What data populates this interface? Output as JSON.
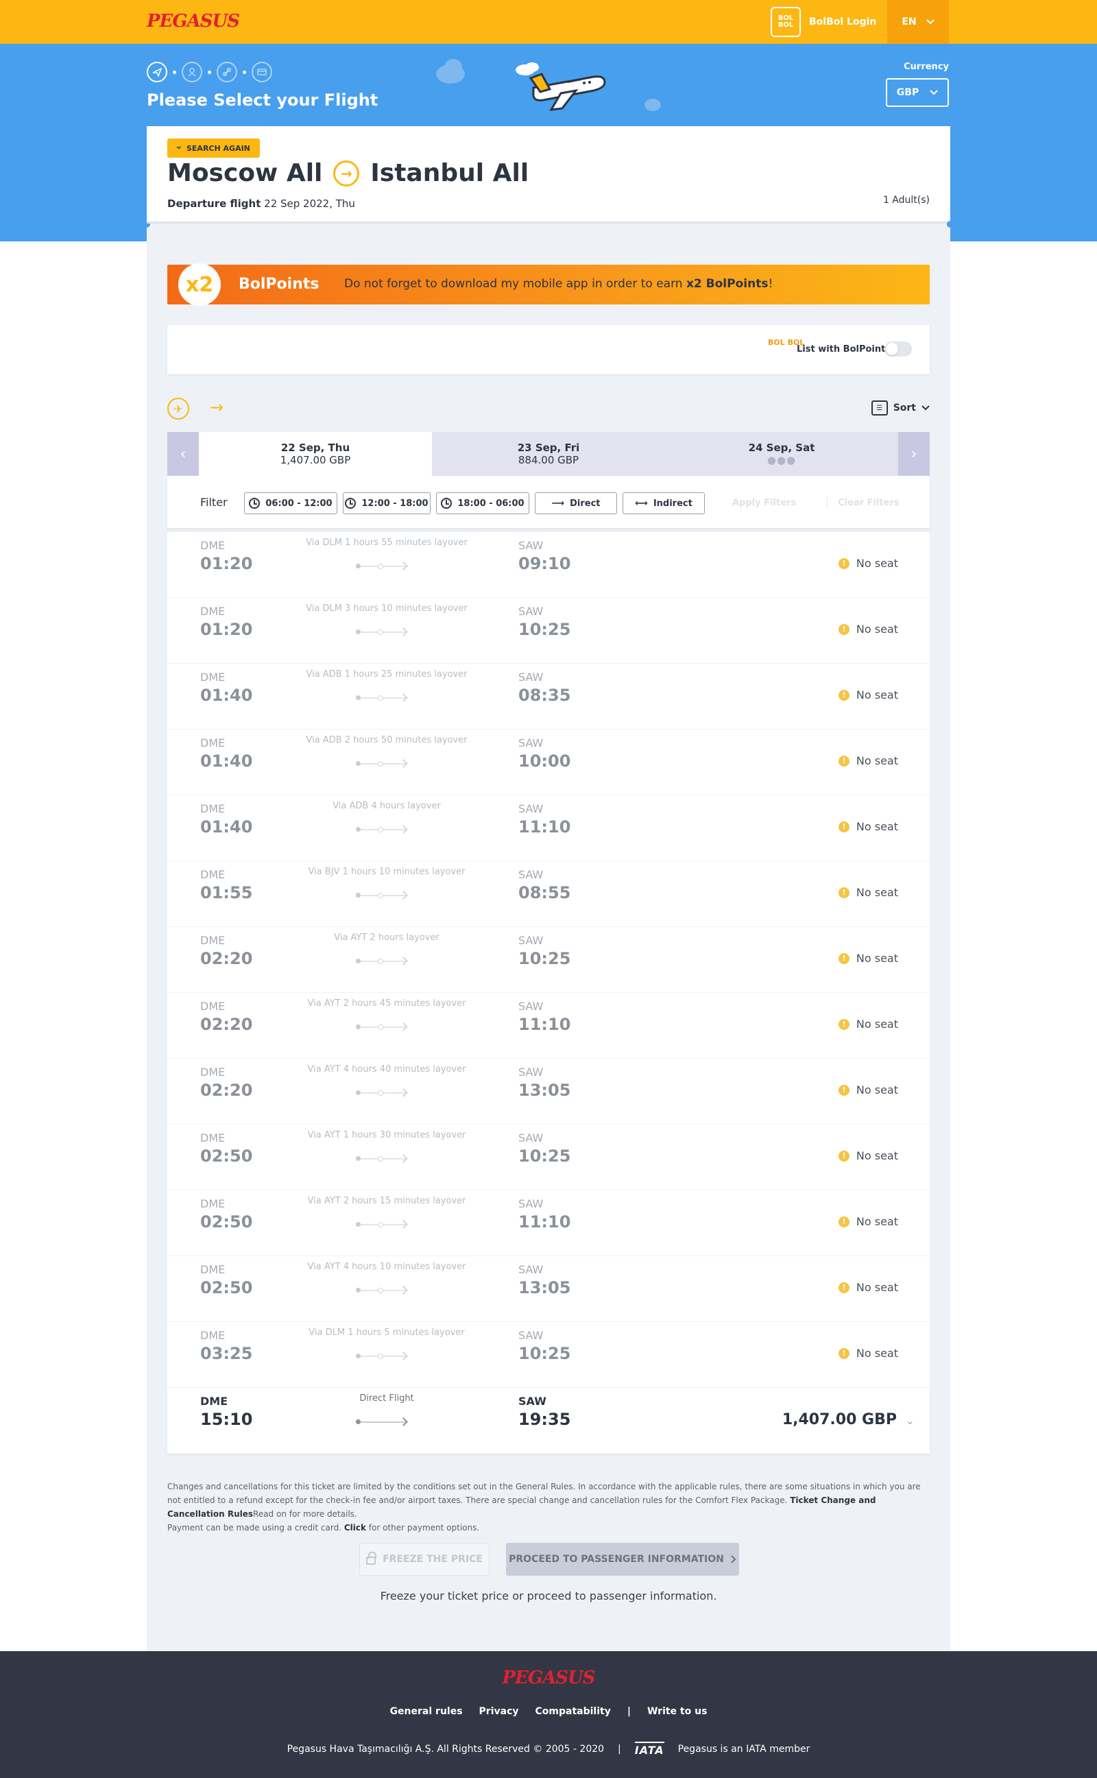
{
  "header": {
    "logo": "PEGASUS",
    "bolbol_badge": "BOL BOL",
    "login_label": "BolBol Login",
    "language": "EN"
  },
  "hero": {
    "title": "Please Select your Flight",
    "currency_label": "Currency",
    "currency_value": "GBP"
  },
  "search": {
    "search_again": "SEARCH AGAIN",
    "origin": "Moscow All",
    "destination": "Istanbul All",
    "departure_label": "Departure flight",
    "departure_date": "22 Sep 2022, Thu",
    "passengers": "1 Adult(s)"
  },
  "promo": {
    "multiplier": "x2",
    "title": "BolPoints",
    "text_before": "Do not forget to download my mobile app in order to earn ",
    "text_bold": "x2 BolPoints",
    "text_after": "!"
  },
  "bolpoints_toggle": {
    "logo": "BOL BOL",
    "label": "List with BolPoints",
    "enabled": false
  },
  "sort_label": "Sort",
  "dates": [
    {
      "date": "22 Sep, Thu",
      "price": "1,407.00 GBP",
      "selected": true
    },
    {
      "date": "23 Sep, Fri",
      "price": "884.00 GBP",
      "selected": false
    },
    {
      "date": "24 Sep, Sat",
      "price": "",
      "selected": false
    }
  ],
  "filters": {
    "label": "Filter",
    "time_slots": [
      "06:00 - 12:00",
      "12:00 - 18:00",
      "18:00 - 06:00"
    ],
    "direct": "Direct",
    "indirect": "Indirect",
    "apply": "Apply Filters",
    "clear": "Clear Filters"
  },
  "flights": [
    {
      "from": "DME",
      "dep": "01:20",
      "via": "Via DLM 1 hours 55 minutes layover",
      "to": "SAW",
      "arr": "09:10",
      "status": "No seat"
    },
    {
      "from": "DME",
      "dep": "01:20",
      "via": "Via DLM 3 hours 10 minutes layover",
      "to": "SAW",
      "arr": "10:25",
      "status": "No seat"
    },
    {
      "from": "DME",
      "dep": "01:40",
      "via": "Via ADB 1 hours 25 minutes layover",
      "to": "SAW",
      "arr": "08:35",
      "status": "No seat"
    },
    {
      "from": "DME",
      "dep": "01:40",
      "via": "Via ADB 2 hours 50 minutes layover",
      "to": "SAW",
      "arr": "10:00",
      "status": "No seat"
    },
    {
      "from": "DME",
      "dep": "01:40",
      "via": "Via ADB 4 hours layover",
      "to": "SAW",
      "arr": "11:10",
      "status": "No seat"
    },
    {
      "from": "DME",
      "dep": "01:55",
      "via": "Via BJV 1 hours 10 minutes layover",
      "to": "SAW",
      "arr": "08:55",
      "status": "No seat"
    },
    {
      "from": "DME",
      "dep": "02:20",
      "via": "Via AYT 2 hours layover",
      "to": "SAW",
      "arr": "10:25",
      "status": "No seat"
    },
    {
      "from": "DME",
      "dep": "02:20",
      "via": "Via AYT 2 hours 45 minutes layover",
      "to": "SAW",
      "arr": "11:10",
      "status": "No seat"
    },
    {
      "from": "DME",
      "dep": "02:20",
      "via": "Via AYT 4 hours 40 minutes layover",
      "to": "SAW",
      "arr": "13:05",
      "status": "No seat"
    },
    {
      "from": "DME",
      "dep": "02:50",
      "via": "Via AYT 1 hours 30 minutes layover",
      "to": "SAW",
      "arr": "10:25",
      "status": "No seat"
    },
    {
      "from": "DME",
      "dep": "02:50",
      "via": "Via AYT 2 hours 15 minutes layover",
      "to": "SAW",
      "arr": "11:10",
      "status": "No seat"
    },
    {
      "from": "DME",
      "dep": "02:50",
      "via": "Via AYT 4 hours 10 minutes layover",
      "to": "SAW",
      "arr": "13:05",
      "status": "No seat"
    },
    {
      "from": "DME",
      "dep": "03:25",
      "via": "Via DLM 1 hours 5 minutes layover",
      "to": "SAW",
      "arr": "10:25",
      "status": "No seat"
    }
  ],
  "direct_flight": {
    "from": "DME",
    "dep": "15:10",
    "via": "Direct Flight",
    "to": "SAW",
    "arr": "19:35",
    "price": "1,407.00 GBP"
  },
  "rules": {
    "text1": "Changes and cancellations for this ticket are limited by the conditions set out in the General Rules. In accordance with the applicable rules, there are some situations in which you are not entitled to a refund except for the check-in fee and/or airport taxes. There are special change and cancellation rules for the Comfort Flex Package. ",
    "link1": "Ticket Change and Cancellation Rules",
    "text2": "Read on for more details.",
    "text3": "Payment can be made using a credit card. ",
    "link2": "Click",
    "text4": " for other payment options."
  },
  "actions": {
    "freeze": "FREEZE THE PRICE",
    "proceed": "PROCEED TO PASSENGER INFORMATION",
    "hint": "Freeze your ticket price or proceed to passenger information."
  },
  "footer": {
    "logo": "PEGASUS",
    "links": [
      "General rules",
      "Privacy",
      "Compatability",
      "Write to us"
    ],
    "separator": "|",
    "copyright": "Pegasus Hava Taşımacılığı A.Ş. All Rights Reserved © 2005 - 2020",
    "iata_logo": "IATA",
    "iata_text": "Pegasus is an IATA member"
  },
  "colors": {
    "brand_yellow": "#fcb713",
    "brand_blue": "#479fed",
    "brand_red": "#e4202d",
    "footer_bg": "#333745"
  }
}
